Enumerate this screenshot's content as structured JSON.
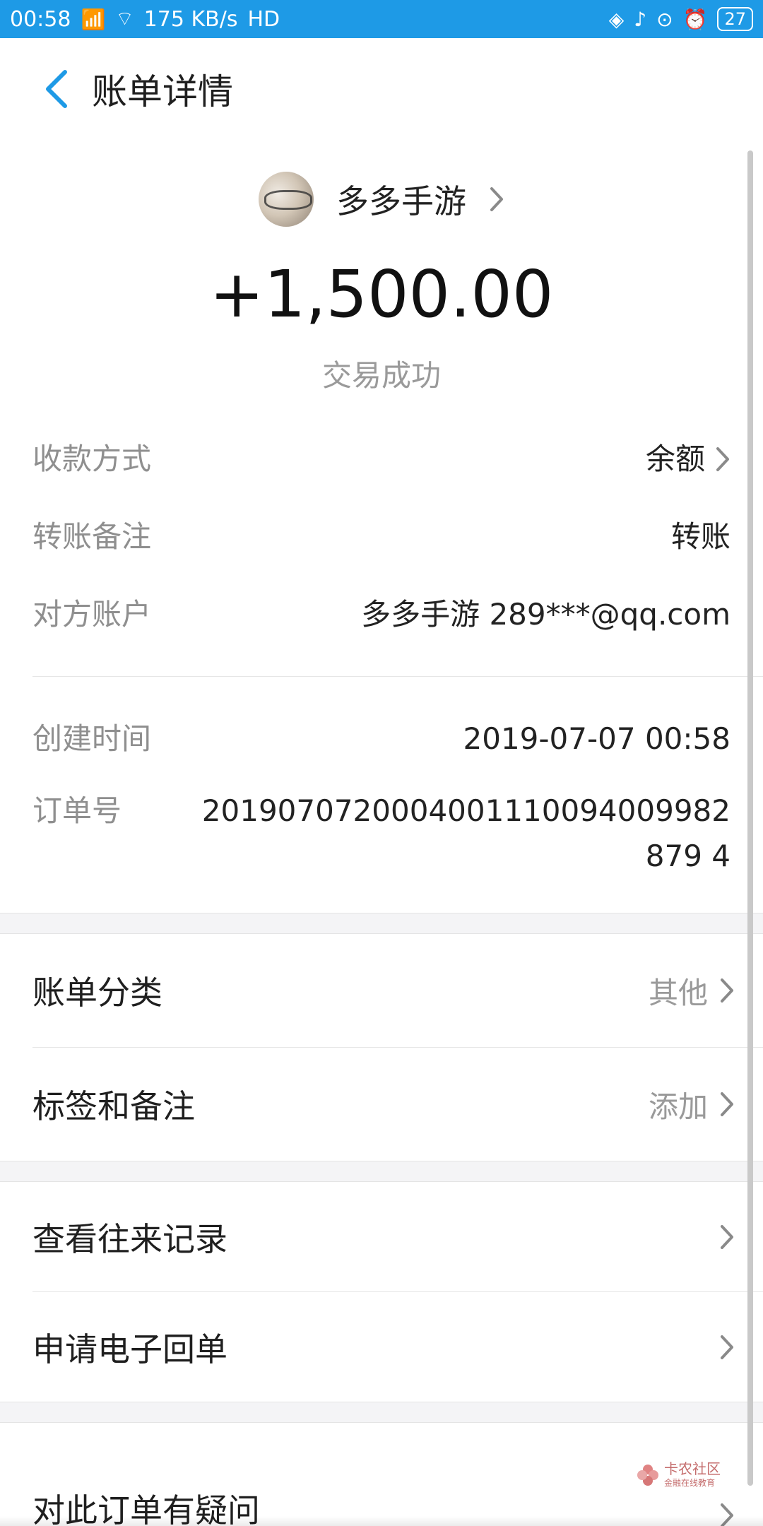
{
  "status_bar": {
    "time": "00:58",
    "network": "4G",
    "speed": "175 KB/s",
    "hd": "HD",
    "battery": "27"
  },
  "nav": {
    "title": "账单详情"
  },
  "hero": {
    "party_name": "多多手游",
    "amount": "+1,500.00",
    "status": "交易成功"
  },
  "details": [
    {
      "label": "收款方式",
      "value": "余额"
    },
    {
      "label": "转账备注",
      "value": "转账"
    },
    {
      "label": "对方账户",
      "value": "多多手游 289***@qq.com"
    },
    {
      "label": "创建时间",
      "value": "2019-07-07 00:58"
    },
    {
      "label": "订单号",
      "value": "2019070720004001110094009982879 4"
    }
  ],
  "category": {
    "label": "账单分类",
    "value": "其他"
  },
  "tags": {
    "label": "标签和备注",
    "value": "添加"
  },
  "actions": [
    {
      "label": "查看往来记录"
    },
    {
      "label": "申请电子回单"
    },
    {
      "label": "对此订单有疑问"
    }
  ],
  "watermark": {
    "line1": "卡农社区",
    "line2": "金融在线教育"
  },
  "colors": {
    "accent": "#1e9ae6",
    "muted": "#9a9a9a"
  }
}
